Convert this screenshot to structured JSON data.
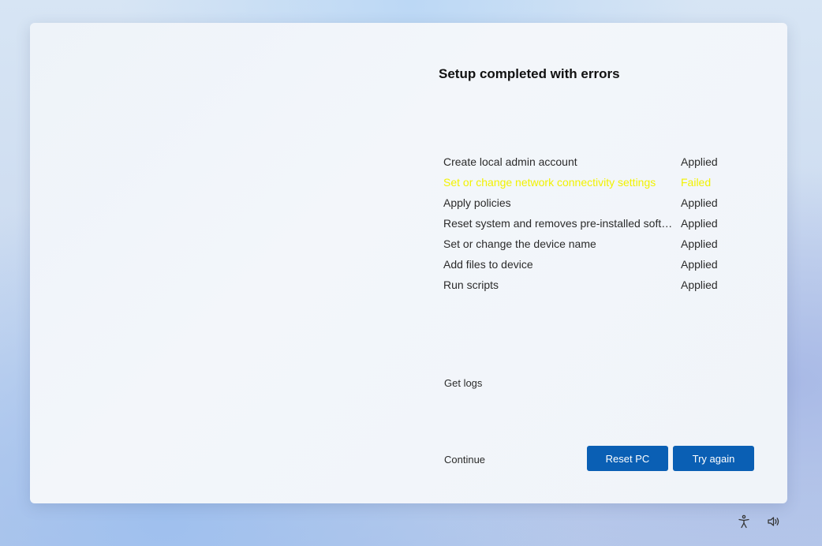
{
  "dialog": {
    "title": "Setup completed with errors",
    "steps": [
      {
        "name": "Create local admin account",
        "status": "Applied"
      },
      {
        "name": "Set or change network connectivity settings",
        "status": "Failed"
      },
      {
        "name": "Apply policies",
        "status": "Applied"
      },
      {
        "name": "Reset system and removes pre-installed software",
        "status": "Applied"
      },
      {
        "name": "Set or change the device name",
        "status": "Applied"
      },
      {
        "name": "Add files to device",
        "status": "Applied"
      },
      {
        "name": "Run scripts",
        "status": "Applied"
      }
    ],
    "get_logs_label": "Get logs",
    "continue_label": "Continue",
    "reset_pc_label": "Reset PC",
    "try_again_label": "Try again"
  },
  "colors": {
    "failed": "#f2f200",
    "button": "#0a5fb4"
  },
  "tray": {
    "icons": [
      "accessibility-icon",
      "volume-icon"
    ]
  }
}
